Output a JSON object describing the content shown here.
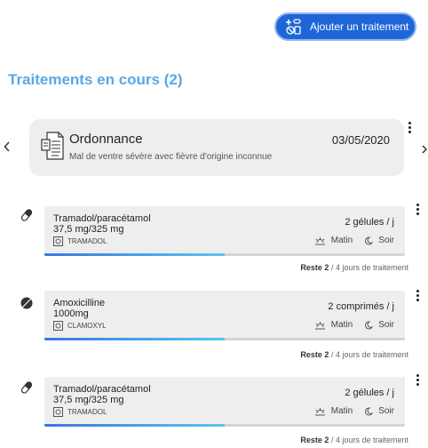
{
  "header": {
    "add_treatment_label": "Ajouter un traitement",
    "accent_color": "#1e66d8"
  },
  "section": {
    "title": "Traitements en cours (2)"
  },
  "carousel": {
    "prev_icon": "chevron-left-icon",
    "next_icon": "chevron-right-icon"
  },
  "prescription": {
    "title": "Ordonnance",
    "description": "Mal de ventre sévère avec fièvre d'origine inconnue",
    "date": "03/05/2020"
  },
  "medications": [
    {
      "icon": "capsule-icon",
      "name": "Tramadol/paracétamol",
      "dose": "37,5 mg/325 mg",
      "brand": "TRAMADOL",
      "quantity": "2 gélules / j",
      "morning": "Matin",
      "evening": "Soir",
      "progress": 0.5,
      "remaining_label": "Reste 2",
      "remaining_suffix": " / 4 jours de traitement"
    },
    {
      "icon": "tablet-icon",
      "name": "Amoxicilline",
      "dose": "1000mg",
      "brand": "CLAMOXYL",
      "quantity": "2 comprimés / j",
      "morning": "Matin",
      "evening": "Soir",
      "progress": 0.5,
      "remaining_label": "Reste 2",
      "remaining_suffix": " / 4 jours de traitement"
    },
    {
      "icon": "capsule-icon",
      "name": "Tramadol/paracétamol",
      "dose": "37,5 mg/325 mg",
      "brand": "TRAMADOL",
      "quantity": "2 gélules / j",
      "morning": "Matin",
      "evening": "Soir",
      "progress": 0.5,
      "remaining_label": "Reste 2",
      "remaining_suffix": " / 4 jours de traitement"
    }
  ]
}
